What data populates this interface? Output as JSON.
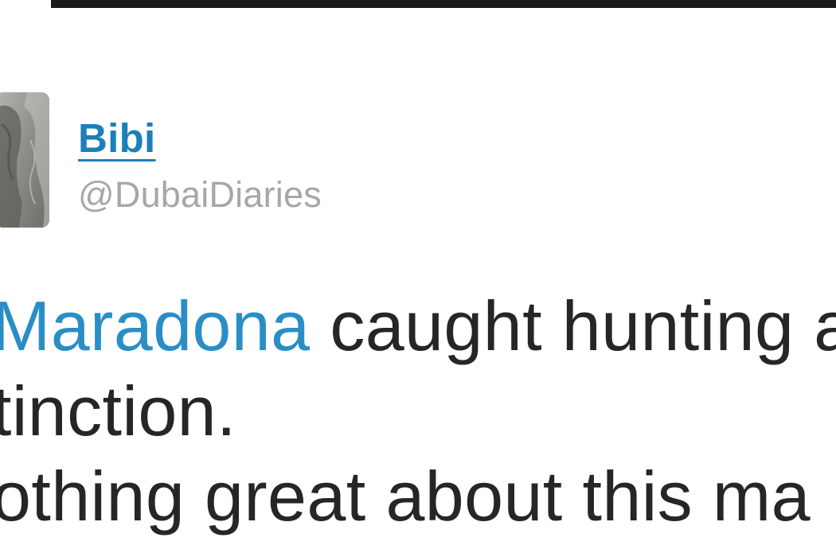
{
  "colors": {
    "link": "#1c7fb8",
    "mention": "#2a8ec6",
    "handle": "#a7a7a7",
    "text": "#262626",
    "top_strip": "#1b1b1b"
  },
  "profile": {
    "avatar_icon": "user-avatar-photo",
    "name": "Bibi",
    "handle": "@DubaiDiaries"
  },
  "tweet": {
    "line1": {
      "mention": "Maradona",
      "text": " caught hunting a"
    },
    "line2": "tinction.",
    "line3": "othing great about this ma"
  }
}
